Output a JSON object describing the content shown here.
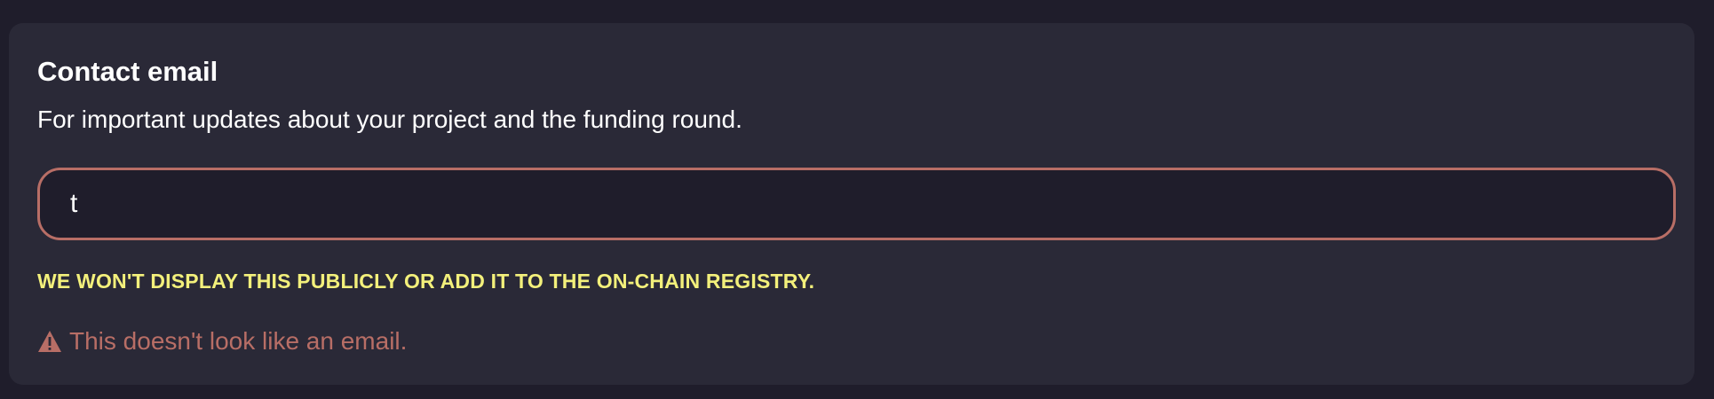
{
  "field": {
    "title": "Contact email",
    "description": "For important updates about your project and the funding round.",
    "input_value": "t",
    "note": "WE WON'T DISPLAY THIS PUBLICLY OR ADD IT TO THE ON-CHAIN REGISTRY.",
    "error_message": "This doesn't look like an email.",
    "error_icon": "warning-icon"
  },
  "colors": {
    "page_background": "#1f1d2b",
    "card_background": "#2a2937",
    "input_background": "#1f1d2b",
    "error_accent": "#b86e66",
    "note_text": "#f3f07b",
    "primary_text": "#ffffff"
  }
}
